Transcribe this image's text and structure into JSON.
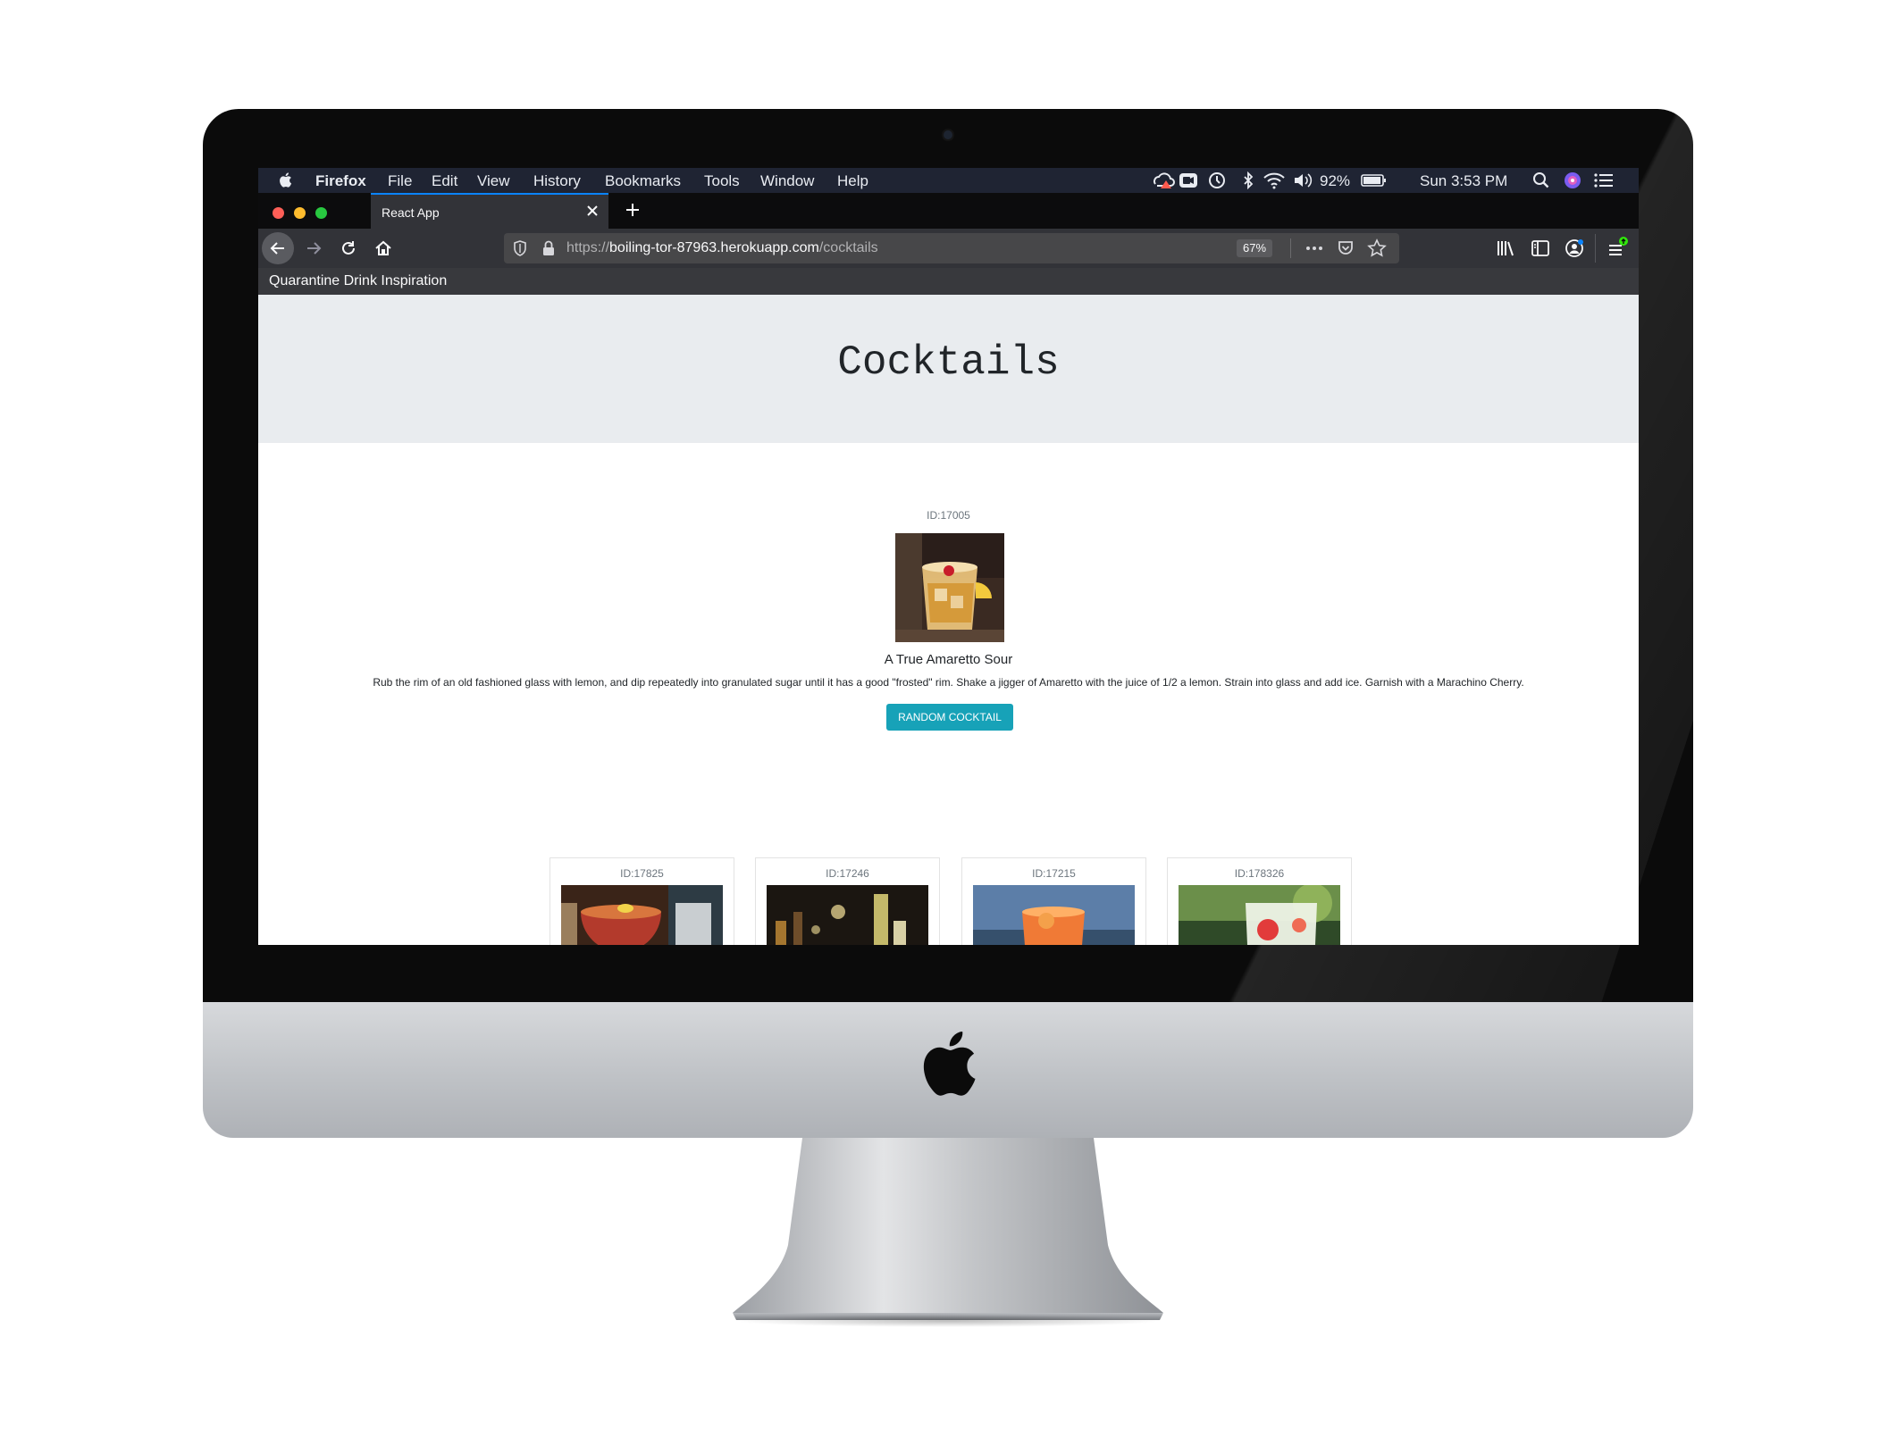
{
  "menubar": {
    "app_name": "Firefox",
    "menus": [
      "File",
      "Edit",
      "View",
      "History",
      "Bookmarks",
      "Tools",
      "Window",
      "Help"
    ],
    "battery_percent": "92%",
    "clock": "Sun 3:53 PM"
  },
  "browser": {
    "tab_title": "React App",
    "url_scheme": "https://",
    "url_host": "boiling-tor-87963.herokuapp.com",
    "url_path": "/cocktails",
    "zoom": "67%",
    "bookmark": "Quarantine Drink Inspiration",
    "accent_color": "#0a84ff"
  },
  "page": {
    "title": "Cocktails",
    "featured": {
      "id_label": "ID:17005",
      "name": "A True Amaretto Sour",
      "description": "Rub the rim of an old fashioned glass with lemon, and dip repeatedly into granulated sugar until it has a good \"frosted\" rim. Shake a jigger of Amaretto with the juice of 1/2 a lemon. Strain into glass and add ice. Garnish with a Marachino Cherry.",
      "button_label": "RANDOM COCKTAIL",
      "button_color": "#17a2b8"
    },
    "cards": [
      {
        "id_label": "ID:17825"
      },
      {
        "id_label": "ID:17246"
      },
      {
        "id_label": "ID:17215"
      },
      {
        "id_label": "ID:178326"
      }
    ]
  }
}
